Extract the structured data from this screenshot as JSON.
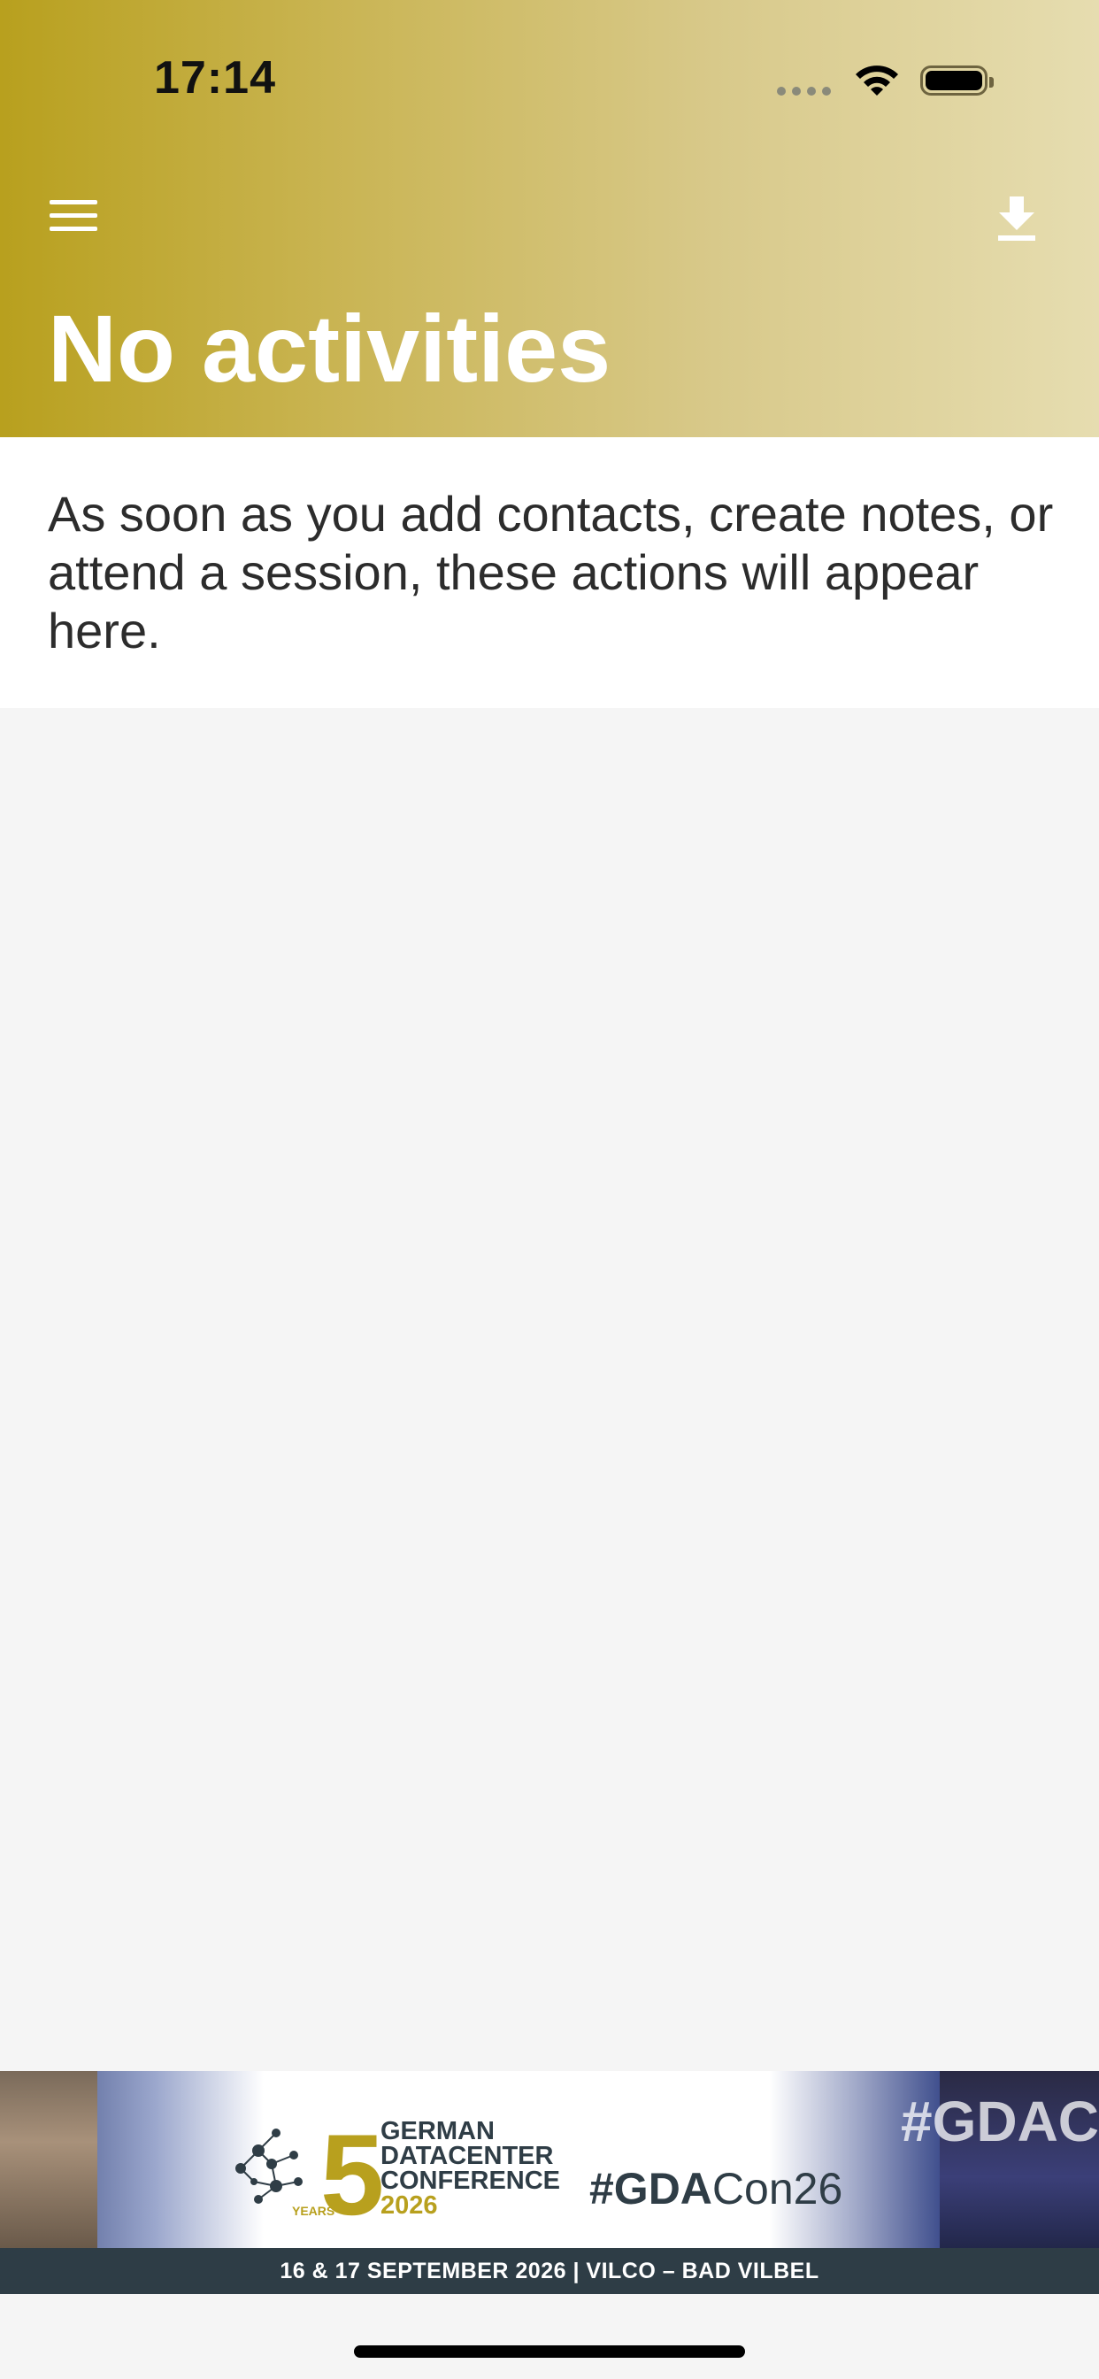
{
  "status_bar": {
    "time": "17:14"
  },
  "header": {
    "title": "No activities",
    "menu_icon": "hamburger-menu-icon",
    "download_icon": "download-icon",
    "gradient_start": "#b8a01e",
    "gradient_end": "#e6ddb0"
  },
  "empty_state": {
    "message": "As soon as you add contacts, create notes, or attend a session, these actions will appear here."
  },
  "banner": {
    "logo_years_label": "YEARS",
    "logo_number": "5",
    "logo_line_1": "GERMAN",
    "logo_line_2": "DATACENTER",
    "logo_line_3": "CONFERENCE",
    "logo_year": "2026",
    "hashtag_bold": "#GDA",
    "hashtag_rest": "Con26",
    "right_hashtag_fragment": "#GDAC",
    "footer_text": "16 & 17 SEPTEMBER 2026 | VILCO – BAD VILBEL",
    "brand_color": "#b8a01e",
    "footer_color": "#2e3d46"
  }
}
